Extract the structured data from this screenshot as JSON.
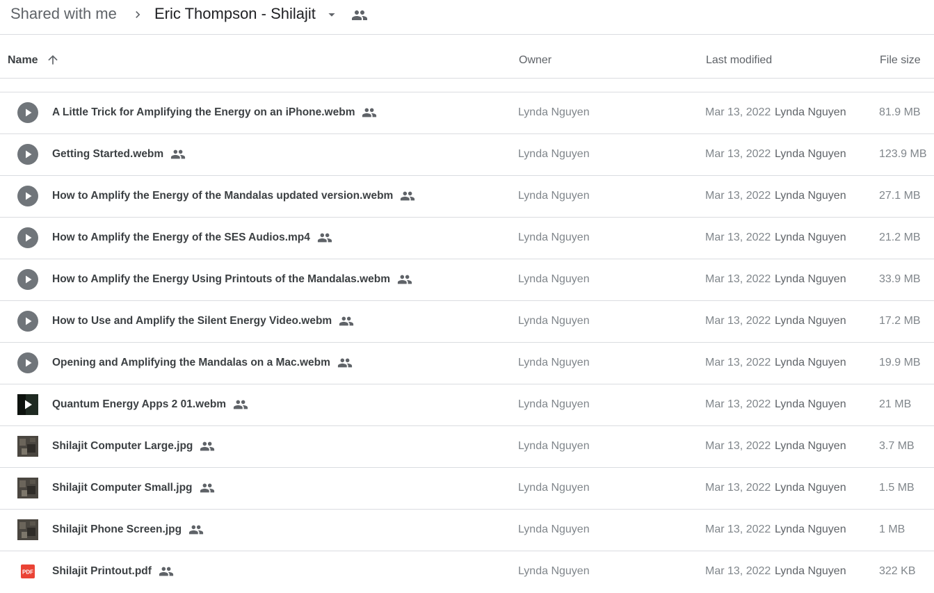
{
  "breadcrumb": {
    "shared_label": "Shared with me",
    "current_folder": "Eric Thompson - Shilajit"
  },
  "columns": {
    "name": "Name",
    "owner": "Owner",
    "last_modified": "Last modified",
    "file_size": "File size"
  },
  "files": [
    {
      "name": "A Little Trick for Amplifying the Energy on an iPhone.webm",
      "type": "video",
      "owner": "Lynda Nguyen",
      "modified": "Mar 13, 2022",
      "modified_by": "Lynda Nguyen",
      "size": "81.9 MB"
    },
    {
      "name": "Getting Started.webm",
      "type": "video",
      "owner": "Lynda Nguyen",
      "modified": "Mar 13, 2022",
      "modified_by": "Lynda Nguyen",
      "size": "123.9 MB"
    },
    {
      "name": "How to Amplify the Energy of the Mandalas updated version.webm",
      "type": "video",
      "owner": "Lynda Nguyen",
      "modified": "Mar 13, 2022",
      "modified_by": "Lynda Nguyen",
      "size": "27.1 MB"
    },
    {
      "name": "How to Amplify the Energy of the SES Audios.mp4",
      "type": "video",
      "owner": "Lynda Nguyen",
      "modified": "Mar 13, 2022",
      "modified_by": "Lynda Nguyen",
      "size": "21.2 MB"
    },
    {
      "name": "How to Amplify the Energy Using Printouts of the Mandalas.webm",
      "type": "video",
      "owner": "Lynda Nguyen",
      "modified": "Mar 13, 2022",
      "modified_by": "Lynda Nguyen",
      "size": "33.9 MB"
    },
    {
      "name": "How to Use and Amplify the Silent Energy Video.webm",
      "type": "video",
      "owner": "Lynda Nguyen",
      "modified": "Mar 13, 2022",
      "modified_by": "Lynda Nguyen",
      "size": "17.2 MB"
    },
    {
      "name": "Opening and Amplifying the Mandalas on a Mac.webm",
      "type": "video",
      "owner": "Lynda Nguyen",
      "modified": "Mar 13, 2022",
      "modified_by": "Lynda Nguyen",
      "size": "19.9 MB"
    },
    {
      "name": "Quantum Energy Apps 2 01.webm",
      "type": "video-dark",
      "owner": "Lynda Nguyen",
      "modified": "Mar 13, 2022",
      "modified_by": "Lynda Nguyen",
      "size": "21 MB"
    },
    {
      "name": "Shilajit Computer Large.jpg",
      "type": "image",
      "owner": "Lynda Nguyen",
      "modified": "Mar 13, 2022",
      "modified_by": "Lynda Nguyen",
      "size": "3.7 MB"
    },
    {
      "name": "Shilajit Computer Small.jpg",
      "type": "image",
      "owner": "Lynda Nguyen",
      "modified": "Mar 13, 2022",
      "modified_by": "Lynda Nguyen",
      "size": "1.5 MB"
    },
    {
      "name": "Shilajit Phone Screen.jpg",
      "type": "image",
      "owner": "Lynda Nguyen",
      "modified": "Mar 13, 2022",
      "modified_by": "Lynda Nguyen",
      "size": "1 MB"
    },
    {
      "name": "Shilajit Printout.pdf",
      "type": "pdf",
      "owner": "Lynda Nguyen",
      "modified": "Mar 13, 2022",
      "modified_by": "Lynda Nguyen",
      "size": "322 KB"
    }
  ],
  "icons": {
    "separator": "chevron-right-icon",
    "dropdown": "arrow-drop-down-icon",
    "shared": "people-icon",
    "sort": "arrow-up-icon",
    "video": "play-circle-icon",
    "image": "image-thumbnail-icon",
    "pdf": "pdf-icon"
  },
  "pdf_badge": "PDF",
  "colors": {
    "text_primary": "#3c4043",
    "text_secondary": "#80868b",
    "divider": "#dadce0",
    "play_icon": "#70757a",
    "pdf_red": "#ea4335"
  }
}
